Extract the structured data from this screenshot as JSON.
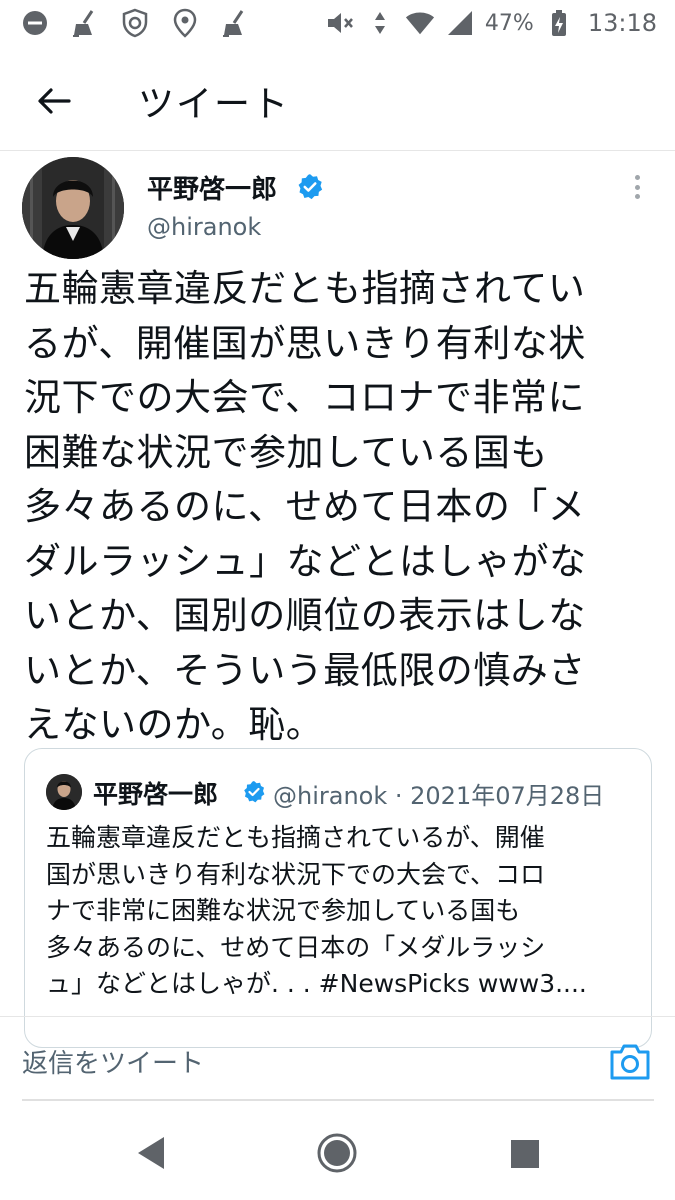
{
  "status_bar": {
    "battery": "47%",
    "time": "13:18",
    "icons": [
      "minus-circle-icon",
      "broom-icon",
      "shield-icon",
      "location-icon",
      "broom-icon",
      "mute-icon",
      "data-arrows-icon",
      "wifi-icon",
      "signal-icon",
      "battery-charging-icon"
    ]
  },
  "header": {
    "title": "ツイート",
    "back_icon": "arrow-left-icon"
  },
  "tweet": {
    "author_name": "平野啓一郎",
    "author_handle": "@hiranok",
    "text": "五輪憲章違反だとも指摘されてい\nるが、開催国が思いきり有利な状\n況下での大会で、コロナで非常に\n困難な状況で参加している国も\n多々あるのに、せめて日本の「メ\nダルラッシュ」などとはしゃがな\nいとか、国別の順位の表示はしな\nいとか、そういう最低限の慎みさ\nえないのか。恥。"
  },
  "quote": {
    "author_name": "平野啓一郎",
    "handle_date": "@hiranok · 2021年07月28日",
    "text": "五輪憲章違反だとも指摘されているが、開催\n国が思いきり有利な状況下での大会で、コロ\nナで非常に困難な状況で参加している国も\n多々あるのに、せめて日本の「メダルラッシ\nュ」などとはしゃが. . .  #NewsPicks www3...."
  },
  "reply": {
    "placeholder": "返信をツイート",
    "camera_icon": "camera-icon"
  },
  "colors": {
    "accent": "#1d9bf0",
    "text": "#0f1419",
    "secondary": "#536471",
    "nav": "#5f6368"
  }
}
